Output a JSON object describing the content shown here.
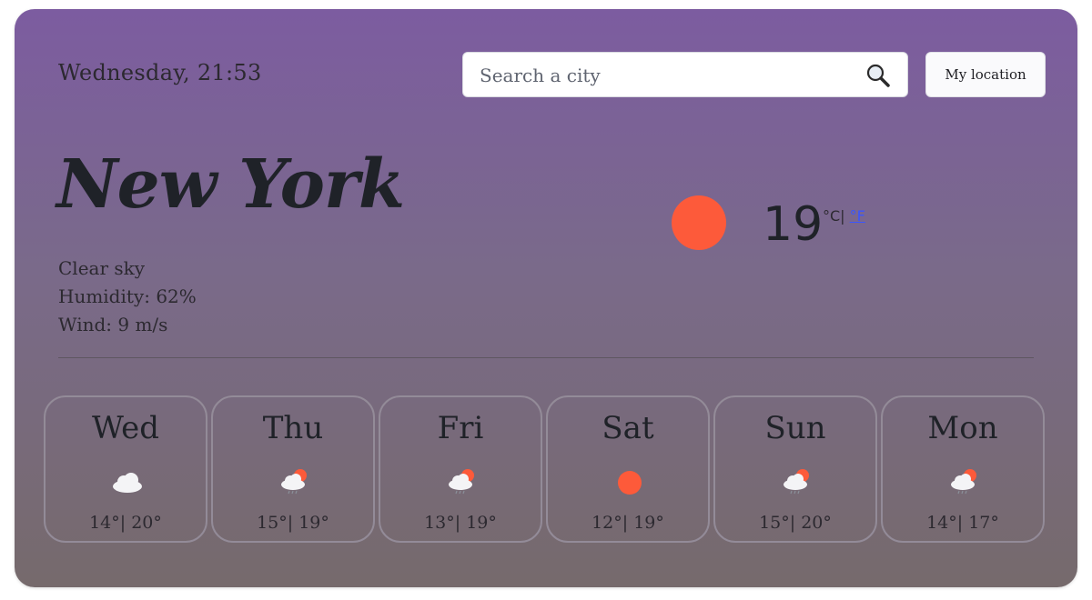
{
  "header": {
    "datetime": "Wednesday, 21:53"
  },
  "search": {
    "placeholder": "Search a city",
    "icon": "magnifier-icon"
  },
  "location_button": {
    "label": "My location"
  },
  "current": {
    "city": "New York",
    "condition": "Clear sky",
    "humidity": "Humidity: 62%",
    "wind": "Wind: 9 m/s",
    "temperature": "19",
    "unit_c": "°C",
    "unit_sep": "|",
    "unit_f": "°F",
    "icon": "sun-icon"
  },
  "forecast": [
    {
      "day": "Wed",
      "temps": "14°| 20°",
      "icon": "cloud-icon"
    },
    {
      "day": "Thu",
      "temps": "15°| 19°",
      "icon": "sun-cloud-rain-icon"
    },
    {
      "day": "Fri",
      "temps": "13°| 19°",
      "icon": "sun-cloud-rain-icon"
    },
    {
      "day": "Sat",
      "temps": "12°| 19°",
      "icon": "sun-icon"
    },
    {
      "day": "Sun",
      "temps": "15°| 20°",
      "icon": "sun-cloud-rain-icon"
    },
    {
      "day": "Mon",
      "temps": "14°| 17°",
      "icon": "sun-cloud-rain-icon"
    }
  ],
  "colors": {
    "sun": "#fd5a3a",
    "card_top": "#7c5ca0",
    "card_bottom": "#766a6c",
    "link": "#3a55ff"
  }
}
